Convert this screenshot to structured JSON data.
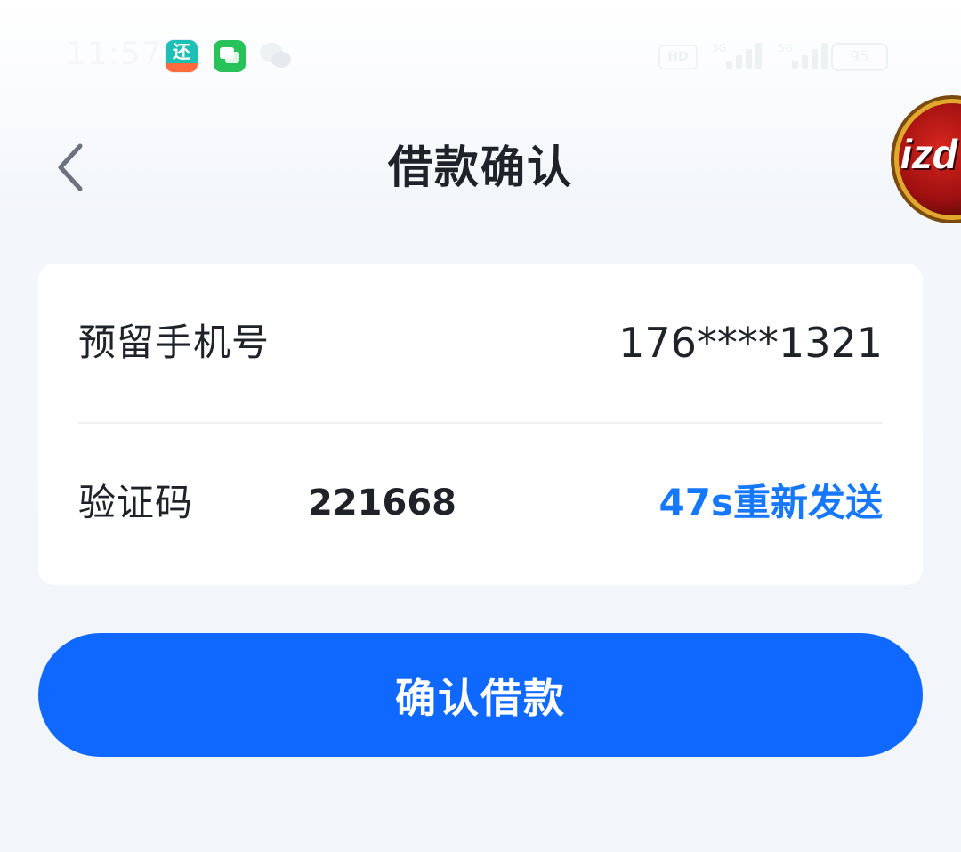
{
  "status_bar": {
    "time": "11:57",
    "notification_icons": [
      "repay-app-icon",
      "messages-icon",
      "wechat-icon"
    ],
    "hd_label": "HD",
    "signal_label": "5G",
    "battery": "95"
  },
  "floating_badge": {
    "text": "izd"
  },
  "header": {
    "title": "借款确认",
    "back_icon": "chevron-left-icon"
  },
  "form": {
    "phone_label": "预留手机号",
    "phone_value": "176****1321",
    "code_label": "验证码",
    "code_value": "221668",
    "resend_label": "47s重新发送"
  },
  "actions": {
    "confirm_label": "确认借款"
  },
  "colors": {
    "accent": "#1677ff",
    "button": "#0f68ff",
    "title": "#1f2329",
    "background": "#f2f5f9"
  }
}
